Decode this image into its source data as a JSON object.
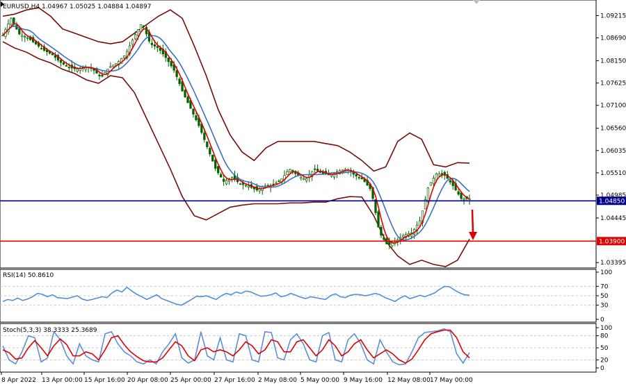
{
  "header": {
    "symbol_info": "EURUSD,H4  1.04967 1.05025 1.04884 1.04897"
  },
  "colors": {
    "candle": "#006400",
    "bollinger": "#7a0b0b",
    "ma_fast": "#e00000",
    "ma_slow": "#3a6fc4",
    "support_line": "#00008b",
    "target_line": "#e00000",
    "rsi_line": "#4f8fd8",
    "stoch_main": "#5b8fd8",
    "stoch_signal": "#e00000",
    "arrow": "#e00000"
  },
  "chart_data": [
    {
      "type": "candlestick",
      "name": "price-panel",
      "title": "EURUSD,H4  1.04967 1.05025 1.04884 1.04897",
      "ylim": [
        1.033,
        1.0955
      ],
      "y_ticks": [
        "1.09215",
        "1.08690",
        "1.08150",
        "1.07625",
        "1.07100",
        "1.06560",
        "1.06035",
        "1.05510",
        "1.04985",
        "1.04445",
        "1.03395"
      ],
      "y_tick_values": [
        1.09215,
        1.0869,
        1.0815,
        1.07625,
        1.071,
        1.0656,
        1.06035,
        1.0551,
        1.04985,
        1.04445,
        1.03395
      ],
      "x_ticks": [
        "8 Apr 2022",
        "13 Apr 00:00",
        "15 Apr 16:00",
        "20 Apr 08:00",
        "25 Apr 00:00",
        "27 Apr 16:00",
        "2 May 08:00",
        "5 May 00:00",
        "9 May 16:00",
        "12 May 08:00",
        "17 May 00:00"
      ],
      "close_anchors": [
        1.0875,
        1.0915,
        1.0878,
        1.087,
        1.0855,
        1.084,
        1.083,
        1.0812,
        1.08,
        1.0795,
        1.0802,
        1.0795,
        1.0775,
        1.08,
        1.081,
        1.083,
        1.087,
        1.0905,
        1.0855,
        1.0845,
        1.082,
        1.079,
        1.074,
        1.07,
        1.066,
        1.061,
        1.056,
        1.053,
        1.054,
        1.0525,
        1.052,
        1.051,
        1.052,
        1.0522,
        1.0535,
        1.056,
        1.0545,
        1.0535,
        1.056,
        1.055,
        1.0545,
        1.0555,
        1.056,
        1.0545,
        1.0535,
        1.051,
        1.041,
        1.038,
        1.039,
        1.0405,
        1.041,
        1.044,
        1.052,
        1.055,
        1.0545,
        1.052,
        1.049,
        1.049
      ],
      "bollinger_upper": [
        1.092,
        1.0925,
        1.0935,
        1.094,
        1.092,
        1.089,
        1.088,
        1.087,
        1.086,
        1.0855,
        1.086,
        1.088,
        1.09,
        1.092,
        1.0935,
        1.0915,
        1.085,
        1.078,
        1.07,
        1.064,
        1.06,
        1.058,
        1.061,
        1.0625,
        1.0625,
        1.0625,
        1.0625,
        1.062,
        1.0615,
        1.06,
        1.058,
        1.0555,
        1.0565,
        1.0625,
        1.0645,
        1.063,
        1.057,
        1.0565,
        1.0575,
        1.0574
      ],
      "bollinger_lower": [
        1.086,
        1.0845,
        1.0835,
        1.082,
        1.081,
        1.0795,
        1.0785,
        1.077,
        1.0762,
        1.078,
        1.0775,
        1.074,
        1.068,
        1.062,
        1.056,
        1.0495,
        1.045,
        1.044,
        1.0455,
        1.047,
        1.0475,
        1.0478,
        1.0478,
        1.0478,
        1.048,
        1.048,
        1.0482,
        1.0482,
        1.049,
        1.0495,
        1.0494,
        1.045,
        1.039,
        1.0355,
        1.0335,
        1.0345,
        1.0335,
        1.033,
        1.0345,
        1.0395
      ],
      "levels": [
        {
          "name": "support",
          "value": 1.0485,
          "label": "1.04850"
        },
        {
          "name": "target",
          "value": 1.039,
          "label": "1.03900"
        }
      ],
      "annotations": [
        {
          "type": "arrow",
          "from": 1.0482,
          "to": 1.04,
          "direction": "down"
        }
      ]
    },
    {
      "type": "line",
      "name": "rsi-panel",
      "title": "RSI(14) 50.8610",
      "ylim": [
        0,
        100
      ],
      "y_ticks": [
        "100",
        "70",
        "50",
        "30",
        "0"
      ],
      "y_tick_values": [
        100,
        70,
        50,
        30,
        0
      ],
      "levels": [
        70,
        50,
        30
      ],
      "series": [
        {
          "name": "RSI(14)",
          "values": [
            38,
            42,
            40,
            45,
            40,
            43,
            48,
            55,
            53,
            48,
            52,
            46,
            45,
            44,
            47,
            50,
            43,
            40,
            42,
            45,
            48,
            46,
            56,
            62,
            58,
            68,
            60,
            53,
            48,
            42,
            47,
            52,
            44,
            40,
            36,
            32,
            30,
            36,
            42,
            49,
            48,
            50,
            46,
            42,
            50,
            55,
            52,
            58,
            55,
            60,
            58,
            53,
            49,
            50,
            52,
            56,
            48,
            50,
            55,
            51,
            47,
            44,
            48,
            46,
            44,
            42,
            50,
            54,
            48,
            46,
            51,
            53,
            52,
            50,
            52,
            55,
            52,
            46,
            42,
            38,
            45,
            50,
            44,
            47,
            51,
            48,
            52,
            56,
            64,
            70,
            69,
            62,
            56,
            52,
            51
          ]
        }
      ]
    },
    {
      "type": "line",
      "name": "stochastic-panel",
      "title": "Stoch(5,3,3) 38.3333 25.3689",
      "ylim": [
        0,
        100
      ],
      "y_ticks": [
        "100",
        "80",
        "50",
        "20",
        "0"
      ],
      "y_tick_values": [
        100,
        80,
        50,
        20,
        0
      ],
      "levels": [
        80,
        50,
        20
      ],
      "series": [
        {
          "name": "Stoch main",
          "values": [
            55,
            20,
            10,
            40,
            80,
            75,
            15,
            25,
            90,
            70,
            30,
            10,
            60,
            30,
            20,
            15,
            85,
            90,
            60,
            40,
            30,
            15,
            10,
            20,
            10,
            40,
            60,
            85,
            25,
            12,
            20,
            90,
            30,
            20,
            75,
            20,
            15,
            85,
            80,
            20,
            15,
            90,
            88,
            25,
            20,
            70,
            85,
            60,
            20,
            15,
            80,
            88,
            20,
            15,
            70,
            85,
            60,
            20,
            10,
            70,
            40,
            15,
            8,
            10,
            40,
            75,
            88,
            90,
            92,
            97,
            90,
            35,
            12,
            38
          ]
        },
        {
          "name": "Stoch signal",
          "values": [
            45,
            38,
            22,
            25,
            50,
            68,
            50,
            30,
            55,
            72,
            58,
            30,
            30,
            40,
            35,
            20,
            45,
            75,
            80,
            58,
            40,
            28,
            18,
            15,
            15,
            25,
            45,
            65,
            55,
            30,
            18,
            45,
            50,
            40,
            45,
            40,
            30,
            45,
            65,
            55,
            35,
            45,
            70,
            65,
            40,
            40,
            65,
            70,
            50,
            30,
            45,
            70,
            55,
            30,
            40,
            60,
            70,
            45,
            25,
            35,
            45,
            35,
            20,
            12,
            22,
            45,
            70,
            85,
            90,
            94,
            94,
            75,
            40,
            25
          ]
        }
      ]
    }
  ],
  "rsi_panel": {
    "label": "RSI(14) 50.8610"
  },
  "stoch_panel": {
    "label": "Stoch(5,3,3) 38.3333 25.3689"
  }
}
